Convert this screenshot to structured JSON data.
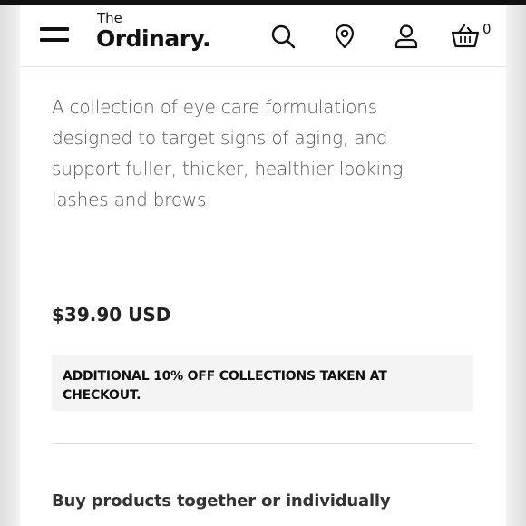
{
  "header": {
    "logo_small": "The",
    "logo_main": "Ordinary.",
    "cart_count": "0",
    "icons": [
      "menu-icon",
      "search-icon",
      "location-pin-icon",
      "user-icon",
      "basket-icon"
    ]
  },
  "product": {
    "description": "A collection of eye care formulations designed to target signs of aging, and support fuller, thicker, healthier-looking lashes and brows.",
    "price": "$39.90 USD",
    "promo": "ADDITIONAL 10% OFF COLLECTIONS TAKEN AT CHECKOUT.",
    "section_heading": "Buy products together or individually"
  },
  "colors": {
    "text_primary": "#111111",
    "text_body": "#555555",
    "promo_bg": "#f4f4f4",
    "divider": "#dcdcdc"
  }
}
